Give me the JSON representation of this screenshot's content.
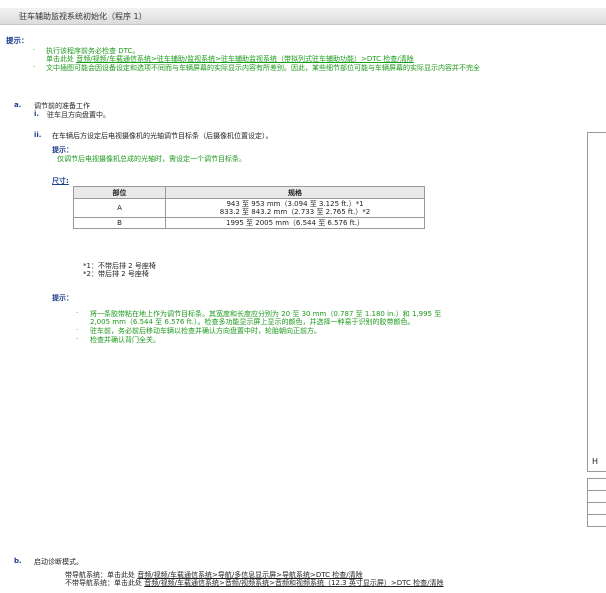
{
  "title": "驻车辅助监视系统初始化（程序 1）",
  "hint_label": "提示：",
  "intro": {
    "bullet1": "执行该程序前务必检查 DTC。",
    "bullet1b_prefix": "单击此处",
    "bullet1b_link": "音频/视频/车载通信系统>驻车辅助/监视系统>驻车辅助监视系统（带拟列式驻车辅助功能）>DTC 检查/清除",
    "bullet2": "文中插图可能会因设备设定和选项不同而与车辆屏幕的实际显示内容有所差别。因此，某些细节部位可能与车辆屏幕的实际显示内容并不完全"
  },
  "step_a": {
    "letter": "a.",
    "title": "调节前的准备工作",
    "sub_i_num": "i.",
    "sub_i": "驻车且方向盘置中。",
    "sub_ii_num": "ii.",
    "sub_ii": "在车辆后方设定后电视摄像机的光轴调节目标条（后摄像机位置设定）。",
    "hint_label": "提示：",
    "hint_text": "仅调节后电视摄像机总成的光轴时，需设定一个调节目标条。",
    "size_label": "尺寸:"
  },
  "spec_table": {
    "headers": [
      "部位",
      "规格"
    ],
    "rows": [
      {
        "part": "A",
        "spec1": "943 至 953 mm（3.094 至 3.125 ft.）*1",
        "spec2": "833.2 至 843.2 mm（2.733 至 2.765 ft.）*2"
      },
      {
        "part": "B",
        "spec1": "1995 至 2005 mm（6.544 至 6.576 ft.）",
        "spec2": ""
      }
    ]
  },
  "footnotes": {
    "n1": "*1：不带后排 2 号座椅",
    "n2": "*2：带后排 2 号座椅"
  },
  "hint2": {
    "label": "提示：",
    "b1_l1": "将一条胶带粘在地上作为调节目标条。其宽度和长度应分别为 20 至 30 mm（0.787 至 1.180 in.）和 1,995 至",
    "b1_l2": "2,005 mm（6.544 至 6.576 ft.）。检查多功能显示屏上显示的颜色，并选择一种易于识别的胶带颜色。",
    "b2": "驻车前，务必前后移动车辆以检查并确认方向盘置中时，轮胎朝向正前方。",
    "b3": "检查并确认背门全关。"
  },
  "right_panel": {
    "label": "H"
  },
  "step_b": {
    "letter": "b.",
    "title": "启动诊断模式。",
    "nav_prefix": "带导航系统：单击此处",
    "nav_link": "音频/视频/车载通信系统>导航/多信息显示屏>导航系统>DTC 检查/清除",
    "nonav_prefix": "不带导航系统：单击此处",
    "nonav_link": "音频/视频/车载通信系统>音频/视频系统>音频和视频系统（12.3 英寸显示屏）>DTC 检查/清除"
  }
}
